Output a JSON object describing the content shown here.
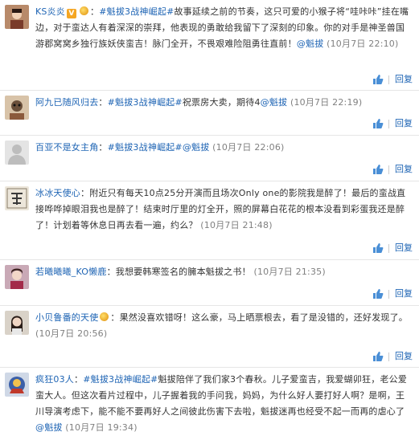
{
  "comments": [
    {
      "user": "KS炎炎",
      "parts": [
        {
          "t": "hashtag",
          "v": "#魁拔3战神崛起#"
        },
        {
          "t": "text",
          "v": "故事延续之前的节奏，这只可爱的小猴子将“哇咔咔”挂在嘴边，对于蛮达人有着深深的崇拜，他表现的勇敢给我留下了深刻的印象。你的对手是神圣兽国游郡窝窝乡独行族妖侠蛮吉！脉门全开，不畏艰难险阻勇往直前！"
        },
        {
          "t": "mention",
          "v": "@魁拔"
        },
        {
          "t": "time",
          "v": " (10月7日 22:10)"
        }
      ],
      "like_icon": "thumbs-up-icon",
      "reply": "回复"
    },
    {
      "user": "阿九已随风归去",
      "parts": [
        {
          "t": "hashtag",
          "v": "#魁拔3战神崛起#"
        },
        {
          "t": "text",
          "v": "祝票房大卖，期待4"
        },
        {
          "t": "mention",
          "v": "@魁拔"
        },
        {
          "t": "time",
          "v": " (10月7日 22:19)"
        }
      ],
      "like_icon": "thumbs-up-icon",
      "reply": "回复"
    },
    {
      "user": "百亚不是女主角",
      "parts": [
        {
          "t": "hashtag",
          "v": "#魁拔3战神崛起#"
        },
        {
          "t": "mention",
          "v": "@魁拔"
        },
        {
          "t": "time",
          "v": " (10月7日 22:06)"
        }
      ],
      "like_icon": "thumbs-up-icon",
      "reply": "回复"
    },
    {
      "user": "冰冰天使心",
      "parts": [
        {
          "t": "text",
          "v": "附近只有每天10点25分开演而且场次Only one的影院我是醉了！最后的蛮战直接哗哗掉眼泪我也是醉了！结束时厅里的灯全开，照的屏幕白花花的根本没看到彩蛋我还是醉了！计划着等休息日再去看一遍，约么？"
        },
        {
          "t": "time",
          "v": " (10月7日 21:48)"
        }
      ],
      "like_icon": "thumbs-up-icon",
      "reply": "回复"
    },
    {
      "user": "若曦曦曦_KO懒鹿",
      "parts": [
        {
          "t": "text",
          "v": "我想要韩寒签名的臃本魁拔之书！"
        },
        {
          "t": "time",
          "v": " (10月7日 21:35)"
        }
      ],
      "like_icon": "thumbs-up-icon",
      "reply": "回复"
    },
    {
      "user": "小贝鲁番的天使",
      "parts": [
        {
          "t": "text",
          "v": "果然没喜欢错呀！这么豪，马上晒票根去，看了是没错的，还好发现了。"
        },
        {
          "t": "time",
          "v": " (10月7日 20:56)"
        }
      ],
      "like_icon": "thumbs-up-icon",
      "reply": "回复"
    },
    {
      "user": "疯狂03人",
      "parts": [
        {
          "t": "hashtag",
          "v": "#魁拔3战神崛起#"
        },
        {
          "t": "text",
          "v": "魁拔陪伴了我们家3个春秋。儿子爱蛮吉，我爱蝴卯狂，老公爱蛮大人。但这次看片过程中，儿子握着我的手问我，妈妈，为什么好人要打好人啊？是啊，王川导演考虑下，能不能不要再好人之间彼此伤害下去啦，魁拔迷再也经受不起一而再的虐心了"
        },
        {
          "t": "mention",
          "v": "@魁拔"
        },
        {
          "t": "time",
          "v": " (10月7日 19:34)"
        }
      ],
      "like_icon": "thumbs-up-icon",
      "reply": "回复"
    }
  ],
  "colors": {
    "link": "#1e64b4",
    "time": "#808080",
    "divider": "#e6e6e6"
  }
}
